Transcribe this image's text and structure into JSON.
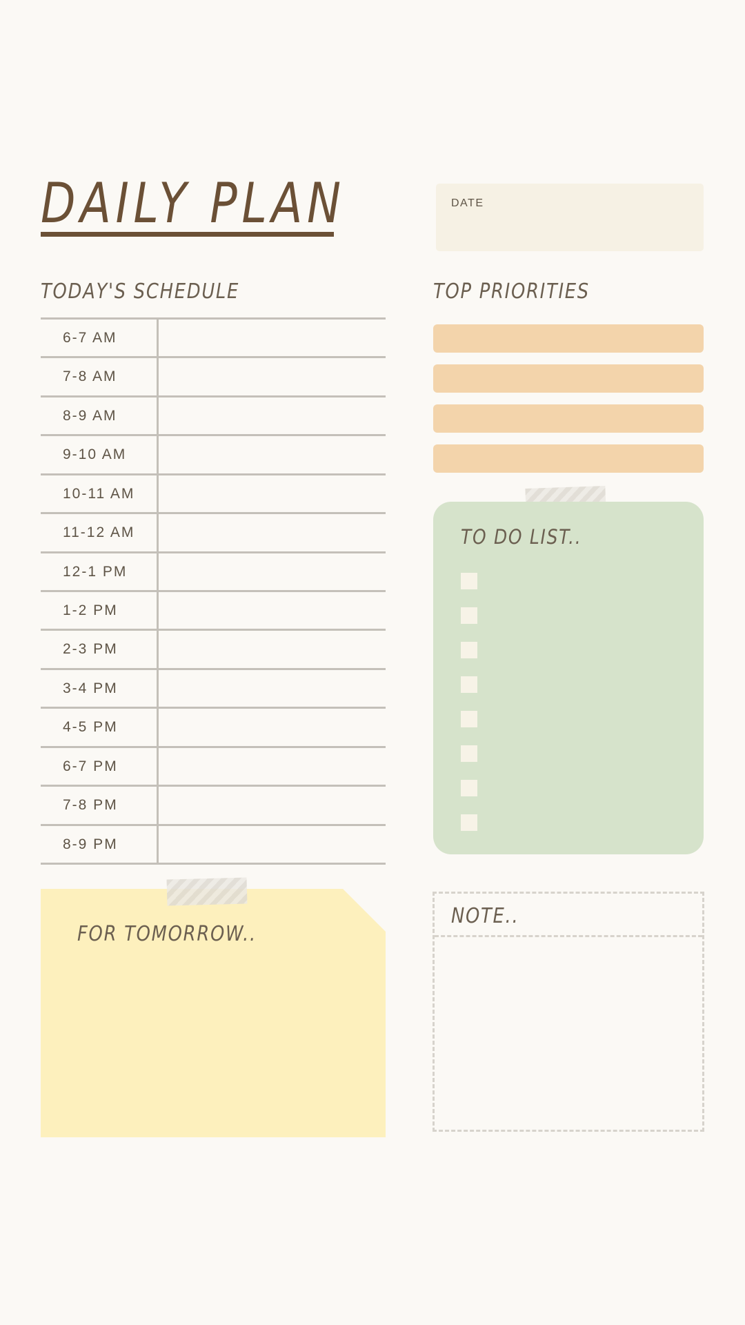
{
  "header": {
    "title": "DAILY PLAN",
    "date_label": "DATE"
  },
  "schedule": {
    "heading": "TODAY'S SCHEDULE",
    "times": [
      "6-7 AM",
      "7-8 AM",
      "8-9 AM",
      "9-10 AM",
      "10-11 AM",
      "11-12 AM",
      "12-1 PM",
      "1-2 PM",
      "2-3 PM",
      "3-4 PM",
      "4-5 PM",
      "6-7 PM",
      "7-8 PM",
      "8-9 PM"
    ]
  },
  "priorities": {
    "heading": "TOP PRIORITIES",
    "count": 4
  },
  "todo": {
    "heading": "TO DO LIST..",
    "checkbox_count": 8
  },
  "tomorrow": {
    "heading": "FOR TOMORROW.."
  },
  "note": {
    "heading": "NOTE.."
  },
  "colors": {
    "background": "#fbf9f5",
    "title": "#6b5036",
    "priority_bar": "#f3d4ab",
    "todo_card": "#d6e3cb",
    "tomorrow_note": "#fdf0bd",
    "date_box": "#f6f1e4"
  }
}
